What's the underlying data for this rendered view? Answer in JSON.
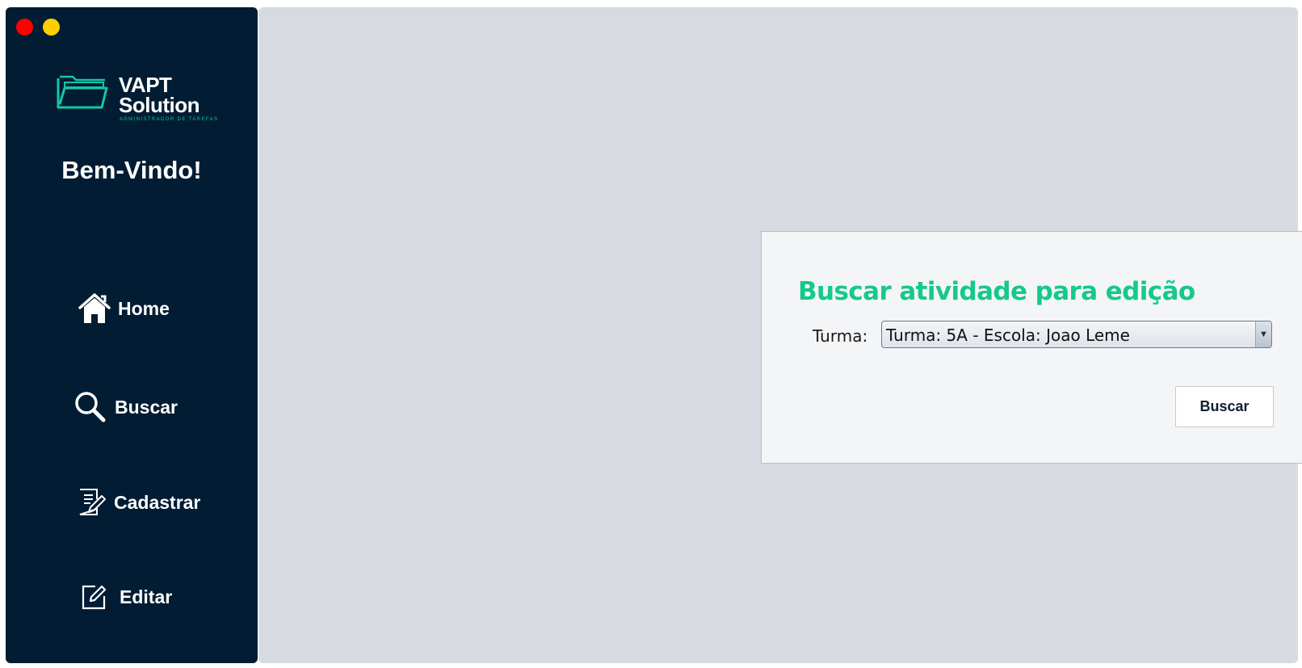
{
  "window_controls": [
    "close",
    "minimize"
  ],
  "brand": {
    "line1": "VAPT",
    "line2": "Solution",
    "tagline": "ADMINISTRADOR DE TAREFAS",
    "logo_icon": "folder-icon"
  },
  "sidebar": {
    "welcome": "Bem-Vindo!",
    "items": [
      {
        "label": "Home",
        "icon": "home-icon"
      },
      {
        "label": "Buscar",
        "icon": "search-icon"
      },
      {
        "label": "Cadastrar",
        "icon": "document-edit-icon"
      },
      {
        "label": "Editar",
        "icon": "edit-icon"
      }
    ]
  },
  "form": {
    "title": "Buscar atividade para edição",
    "turma_label": "Turma:",
    "turma_value": "Turma: 5A - Escola: Joao Leme",
    "submit_label": "Buscar"
  },
  "colors": {
    "sidebar_bg": "#021d33",
    "accent": "#14c98c",
    "main_bg": "#d7dae0",
    "card_bg": "#f4f5f7",
    "close": "#ff0000",
    "minimize": "#ffd000"
  }
}
